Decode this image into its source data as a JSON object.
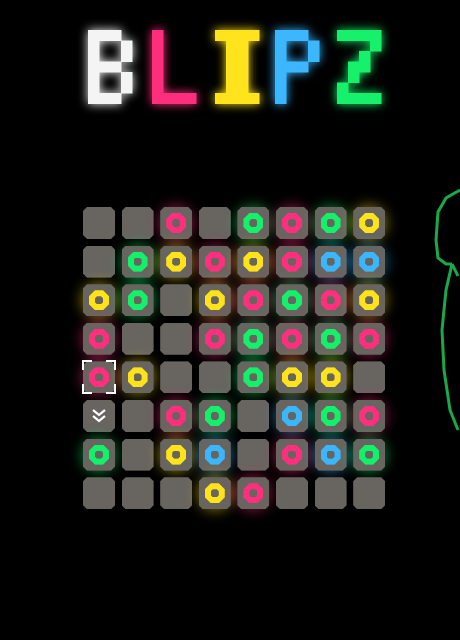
{
  "title": {
    "letters": [
      {
        "char": "B",
        "color": "#f4f4f4"
      },
      {
        "char": "L",
        "color": "#ff2f7d"
      },
      {
        "char": "I",
        "color": "#ffe31a"
      },
      {
        "char": "P",
        "color": "#3ab6ff"
      },
      {
        "char": "Z",
        "color": "#14f06a"
      }
    ]
  },
  "palette": {
    "p": "#ff2f7d",
    "g": "#14f06a",
    "y": "#ffe31a",
    "b": "#3ab6ff",
    "cell": "#686460"
  },
  "board": {
    "rows": [
      [
        ".",
        ".",
        "p",
        ".",
        "g",
        "p",
        "g",
        "y"
      ],
      [
        ".",
        "g",
        "y",
        "p",
        "y",
        "p",
        "b",
        "b"
      ],
      [
        "y",
        "g",
        ".",
        "y",
        "p",
        "g",
        "p",
        "y"
      ],
      [
        "p",
        ".",
        ".",
        "p",
        "g",
        "p",
        "g",
        "p"
      ],
      [
        "p",
        "y",
        ".",
        ".",
        "g",
        "y",
        "y",
        "."
      ],
      [
        "chevron",
        ".",
        "p",
        "g",
        ".",
        "b",
        "g",
        "p"
      ],
      [
        "g",
        ".",
        "y",
        "b",
        ".",
        "p",
        "b",
        "g"
      ],
      [
        ".",
        ".",
        ".",
        "y",
        "p",
        ".",
        ".",
        "."
      ]
    ],
    "cursor": {
      "row": 4,
      "col": 0
    }
  }
}
